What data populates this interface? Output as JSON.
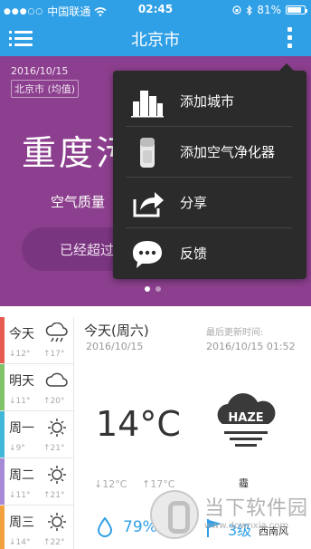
{
  "status_bar": {
    "carrier": "中国联通",
    "time": "02:45",
    "battery": "81%",
    "battery_level": 0.81
  },
  "nav": {
    "title": "北京市",
    "menu_icon": "hamburger-icon",
    "more_icon": "more-vertical-icon"
  },
  "hero": {
    "date": "2016/10/15",
    "location": "北京市 (均值)",
    "level": "重度污",
    "quality": "空气质量",
    "pill_text": "已经超过",
    "background": "#8c3f8e",
    "pages": 2,
    "active_page": 0
  },
  "popup_menu": {
    "items": [
      {
        "label": "添加城市",
        "icon": "city-buildings-icon"
      },
      {
        "label": "添加空气净化器",
        "icon": "air-purifier-icon"
      },
      {
        "label": "分享",
        "icon": "share-icon"
      },
      {
        "label": "反馈",
        "icon": "feedback-chat-icon"
      }
    ]
  },
  "forecast": [
    {
      "day": "今天",
      "icon": "rain-cloud-icon",
      "low": "↓12°",
      "high": "↑17°",
      "color": "#e75a4f"
    },
    {
      "day": "明天",
      "icon": "cloud-icon",
      "low": "↓11°",
      "high": "↑20°",
      "color": "#7fc36b"
    },
    {
      "day": "周一",
      "icon": "sun-icon",
      "low": "↓9°",
      "high": "↑21°",
      "color": "#3fb7d8"
    },
    {
      "day": "周二",
      "icon": "sun-icon",
      "low": "↓11°",
      "high": "↑21°",
      "color": "#a78ad6"
    },
    {
      "day": "周三",
      "icon": "sun-icon",
      "low": "↓14°",
      "high": "↑22°",
      "color": "#f2a13c"
    }
  ],
  "today": {
    "label": "今天(周六)",
    "date": "2016/10/15",
    "updated_label": "最后更新时间:",
    "updated_time": "2016/10/15 01:52",
    "temperature": "14°C",
    "low": "↓12°C",
    "high": "↑17°C",
    "condition": "霾",
    "condition_icon": "haze-icon",
    "haze_text": "HAZE",
    "humidity": "79%",
    "wind_level": "3级",
    "wind_dir": "西南风"
  },
  "watermark": {
    "name": "当下软件园",
    "url": "www.downxia.com"
  },
  "colors": {
    "accent": "#2f9fe6",
    "popup": "#2b2b2b"
  }
}
